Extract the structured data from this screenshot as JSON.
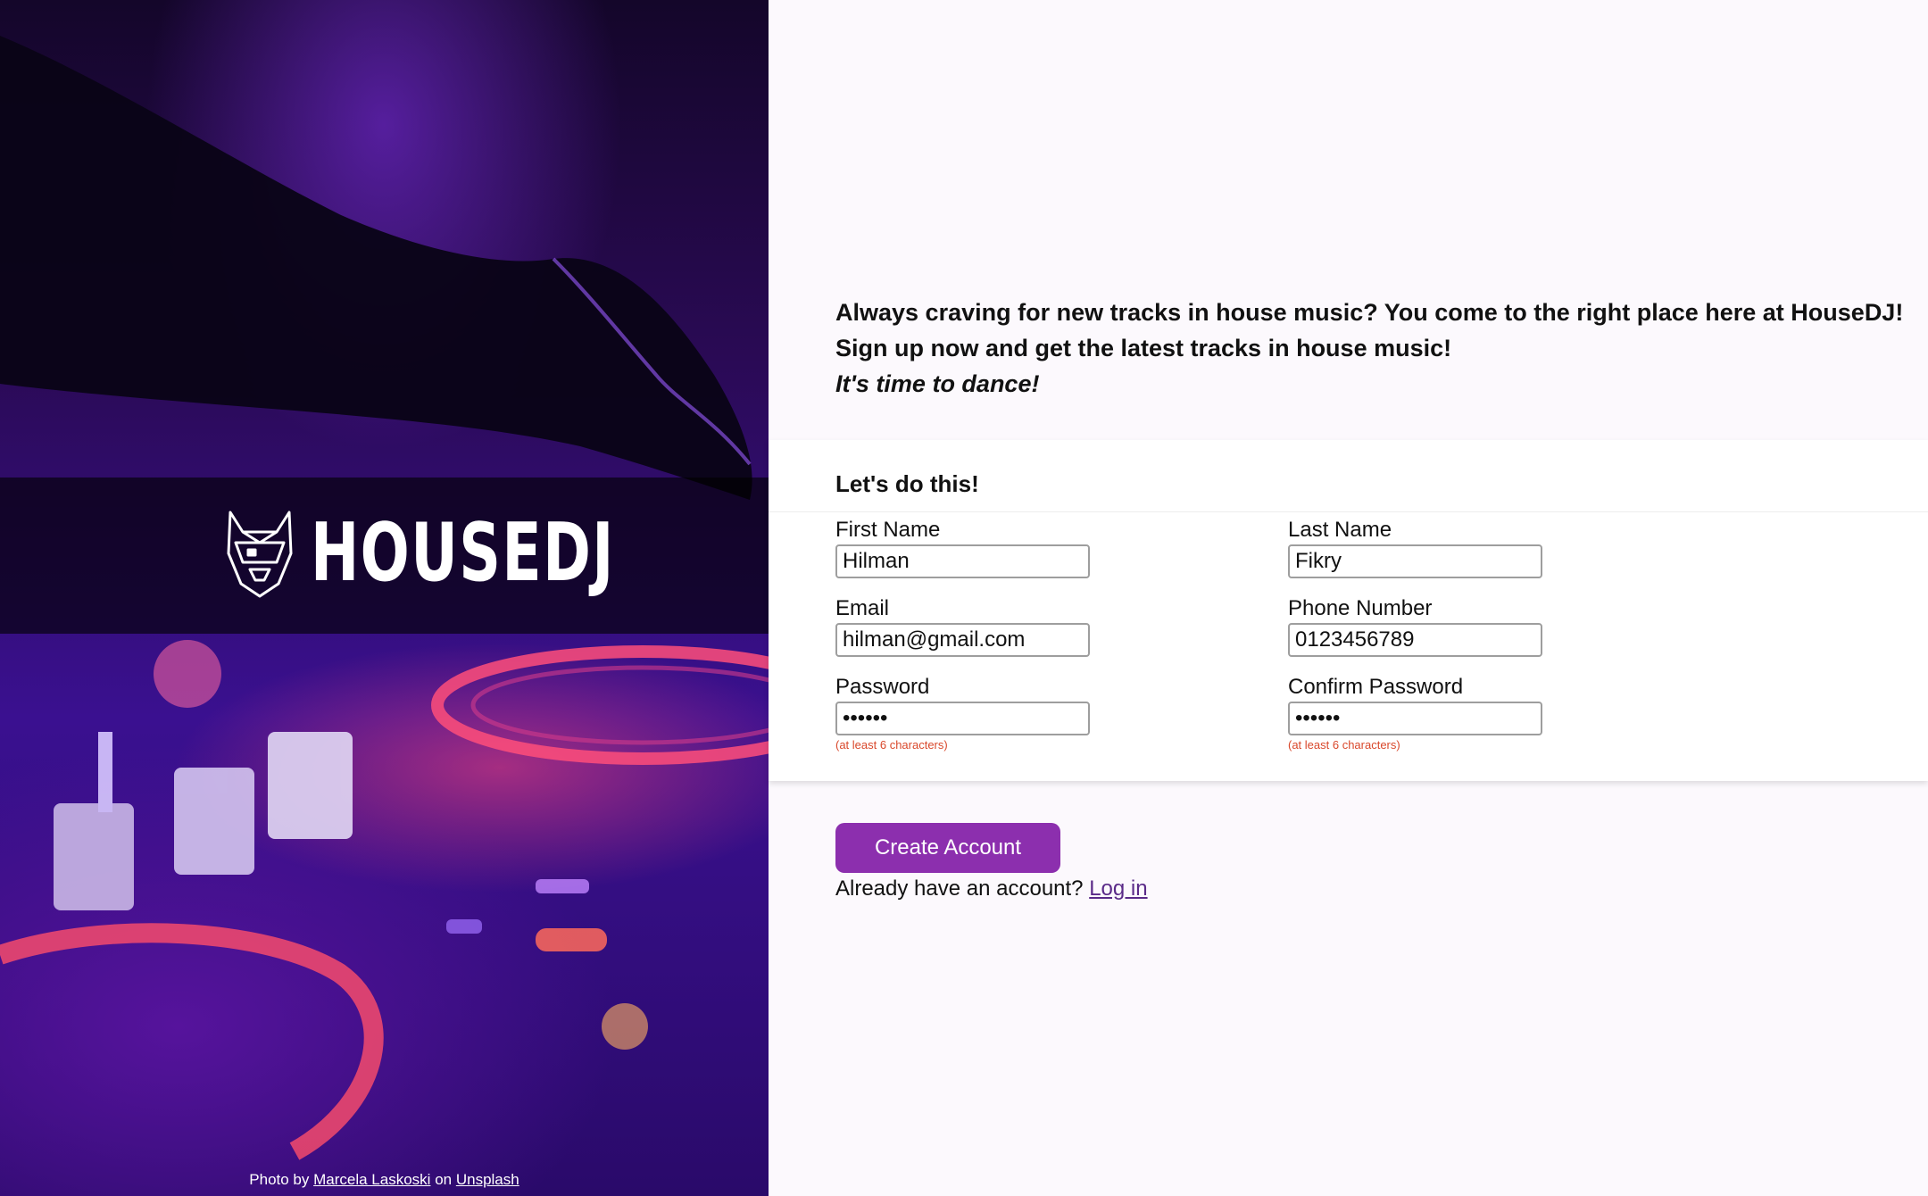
{
  "hero": {
    "brand": "HOUSEDJ",
    "credit": {
      "prefix": "Photo by",
      "author": "Marcela Laskoski",
      "middle": "on",
      "site": "Unsplash"
    }
  },
  "intro": {
    "line1": "Always craving for new tracks in house music? You come to the right place here at HouseDJ!",
    "line2": "Sign up now and get the latest tracks in house music!",
    "tagline": "It's time to dance!"
  },
  "form": {
    "heading": "Let's do this!",
    "first_name": {
      "label": "First Name",
      "value": "Hilman"
    },
    "last_name": {
      "label": "Last Name",
      "value": "Fikry"
    },
    "email": {
      "label": "Email",
      "value": "hilman@gmail.com"
    },
    "phone": {
      "label": "Phone Number",
      "value": "0123456789"
    },
    "password": {
      "label": "Password",
      "value": "••••••",
      "hint": "(at least 6 characters)"
    },
    "confirm_password": {
      "label": "Confirm Password",
      "value": "••••••",
      "hint": "(at least 6 characters)"
    },
    "submit_label": "Create Account",
    "login_prompt": "Already have an account?",
    "login_link": "Log in"
  },
  "colors": {
    "accent": "#8c2fae",
    "hint": "#d9482b",
    "link": "#5a2a88",
    "page_bg": "#fcf9fd"
  }
}
